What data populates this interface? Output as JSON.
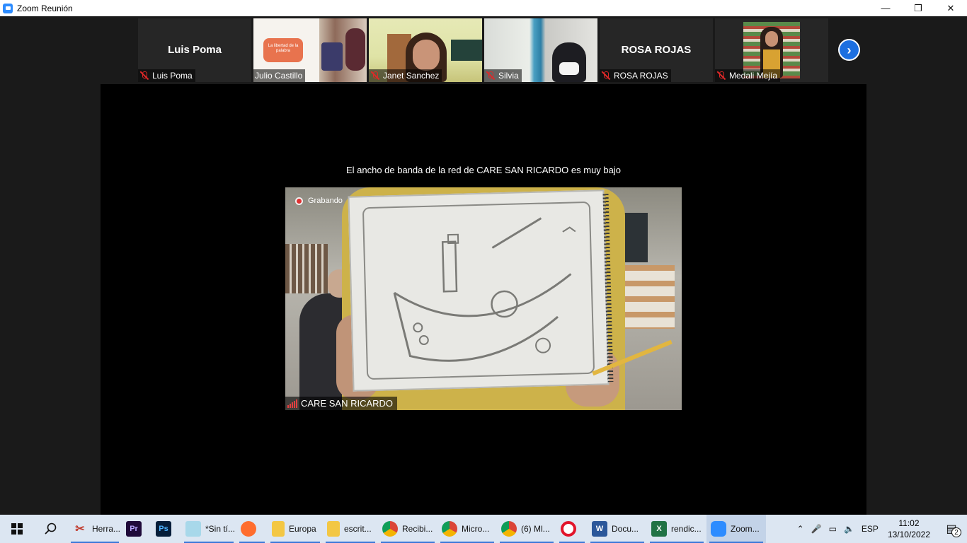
{
  "window": {
    "title": "Zoom Reunión"
  },
  "participants": [
    {
      "name": "Luis Poma",
      "display_name": "Luis Poma",
      "muted": true,
      "video": false
    },
    {
      "name": "Julio Castillo",
      "muted": false,
      "video": true,
      "overlay_text": "La libertad de la palabra"
    },
    {
      "name": "Janet Sanchez",
      "muted": true,
      "video": true
    },
    {
      "name": "Silvia",
      "muted": true,
      "video": true
    },
    {
      "name": "ROSA ROJAS",
      "display_name": "ROSA ROJAS",
      "muted": true,
      "video": false
    },
    {
      "name": "Medali Mejía",
      "muted": true,
      "video": true
    }
  ],
  "stage": {
    "bandwidth_message": "El ancho de banda de la red de CARE SAN RICARDO es muy bajo",
    "recording_label": "Grabando",
    "speaker_name": "CARE SAN RICARDO"
  },
  "taskbar": {
    "items": [
      {
        "label": "Herra...",
        "icon": "snipping-tool-icon"
      },
      {
        "label": "",
        "icon": "premiere-pro-icon",
        "icon_text": "Pr"
      },
      {
        "label": "",
        "icon": "photoshop-icon",
        "icon_text": "Ps"
      },
      {
        "label": "*Sin tí...",
        "icon": "notepad-icon"
      },
      {
        "label": "",
        "icon": "firefox-icon"
      },
      {
        "label": "Europa",
        "icon": "folder-icon"
      },
      {
        "label": "escrit...",
        "icon": "folder-icon"
      },
      {
        "label": "Recibi...",
        "icon": "chrome-icon"
      },
      {
        "label": "Micro...",
        "icon": "chrome-icon"
      },
      {
        "label": "(6) Ml...",
        "icon": "chrome-icon"
      },
      {
        "label": "",
        "icon": "opera-icon"
      },
      {
        "label": "Docu...",
        "icon": "word-icon"
      },
      {
        "label": "rendic...",
        "icon": "excel-icon"
      },
      {
        "label": "Zoom...",
        "icon": "zoom-icon"
      }
    ],
    "tray": {
      "language": "ESP",
      "time": "11:02",
      "date": "13/10/2022",
      "notifications": "2"
    }
  },
  "colors": {
    "zoom_blue": "#2d8cff",
    "muted_red": "#e02828",
    "taskbar_bg": "#dce6f2"
  }
}
